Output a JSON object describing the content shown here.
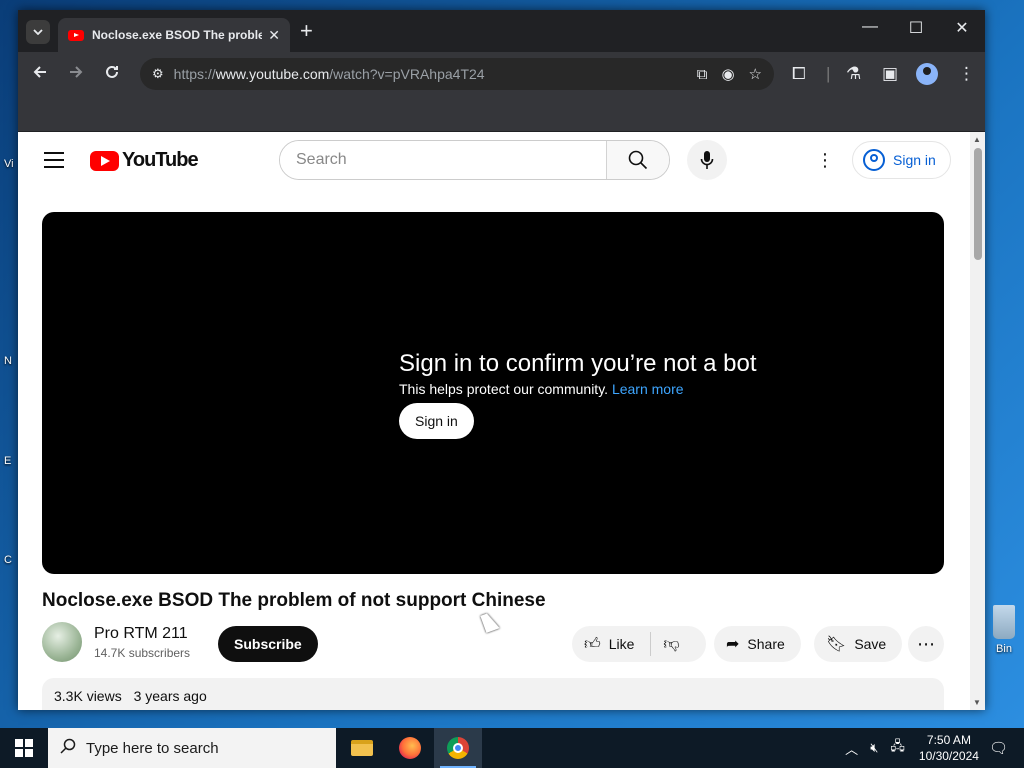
{
  "browser": {
    "tab_title": "Noclose.exe BSOD The problem of not support Chinese",
    "url_prefix": "https://",
    "url_host": "www.youtube.com",
    "url_path": "/watch?v=pVRAhpa4T24"
  },
  "youtube": {
    "logo_text": "YouTube",
    "search_placeholder": "Search",
    "signin_label": "Sign in",
    "bot_title": "Sign in to confirm you’re not a bot",
    "bot_subtitle": "This helps protect our community.",
    "bot_learn_more": "Learn more",
    "bot_signin_label": "Sign in",
    "video_title": "Noclose.exe BSOD The problem of not support Chinese",
    "channel_name": "Pro RTM 211",
    "subscribers": "14.7K subscribers",
    "subscribe_label": "Subscribe",
    "like_label": "Like",
    "share_label": "Share",
    "save_label": "Save",
    "views": "3.3K views",
    "upload_age": "3 years ago"
  },
  "desktop": {
    "recycle_bin_label": "Bin",
    "left_icon_fragments": [
      "Vi",
      "N",
      "E",
      "C"
    ]
  },
  "taskbar": {
    "search_placeholder": "Type here to search",
    "time": "7:50 AM",
    "date": "10/30/2024"
  }
}
